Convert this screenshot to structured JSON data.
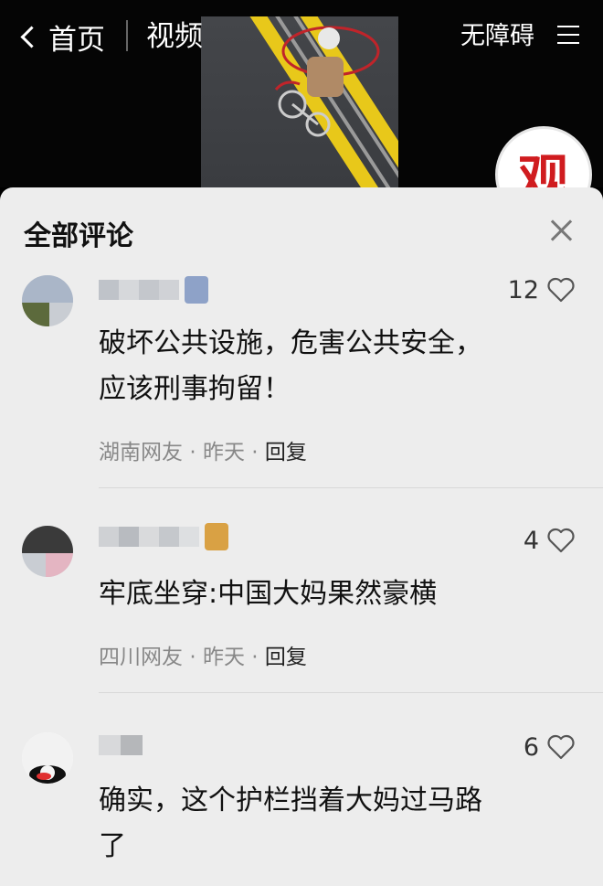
{
  "topbar": {
    "back_label": "首页",
    "tab_label": "视频",
    "accessibility_label": "无障碍",
    "logo_text": "观"
  },
  "sheet": {
    "title": "全部评论"
  },
  "comments": [
    {
      "text_line1": "破坏公共设施，危害公共安全，",
      "text_line2": "应该刑事拘留！",
      "likes": "12",
      "region": "湖南网友",
      "time": "昨天",
      "reply": "回复",
      "dot": "·",
      "badge_color": "#8ea2c8"
    },
    {
      "text_line1": "牢底坐穿:中国大妈果然豪横",
      "text_line2": "",
      "likes": "4",
      "region": "四川网友",
      "time": "昨天",
      "reply": "回复",
      "dot": "·",
      "badge_color": "#d9a144"
    },
    {
      "text_line1": "确实，这个护栏挡着大妈过马路",
      "text_line2": "了",
      "likes": "6"
    }
  ],
  "icons": {
    "back": "chevron-left-icon",
    "menu": "menu-icon",
    "close": "close-icon",
    "like": "heart-icon"
  }
}
